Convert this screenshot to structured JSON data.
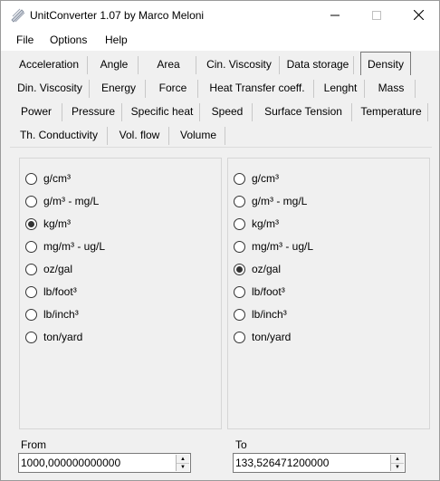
{
  "window": {
    "title": "UnitConverter 1.07 by Marco Meloni"
  },
  "menu": [
    "File",
    "Options",
    "Help"
  ],
  "tabs": {
    "row1": [
      "Acceleration",
      "Angle",
      "Area",
      "Cin. Viscosity",
      "Data storage",
      "Density"
    ],
    "row2": [
      "Din. Viscosity",
      "Energy",
      "Force",
      "Heat Transfer coeff.",
      "Lenght",
      "Mass"
    ],
    "row3": [
      "Power",
      "Pressure",
      "Specific heat",
      "Speed",
      "Surface Tension",
      "Temperature"
    ],
    "row4": [
      "Th. Conductivity",
      "Vol. flow",
      "Volume"
    ],
    "active": "Density"
  },
  "units": [
    "g/cm³",
    "g/m³ - mg/L",
    "kg/m³",
    "mg/m³ - ug/L",
    "oz/gal",
    "lb/foot³",
    "lb/inch³",
    "ton/yard"
  ],
  "from": {
    "selected": "kg/m³",
    "label": "From",
    "value": "1000,000000000000"
  },
  "to": {
    "selected": "oz/gal",
    "label": "To",
    "value": "133,526471200000"
  }
}
